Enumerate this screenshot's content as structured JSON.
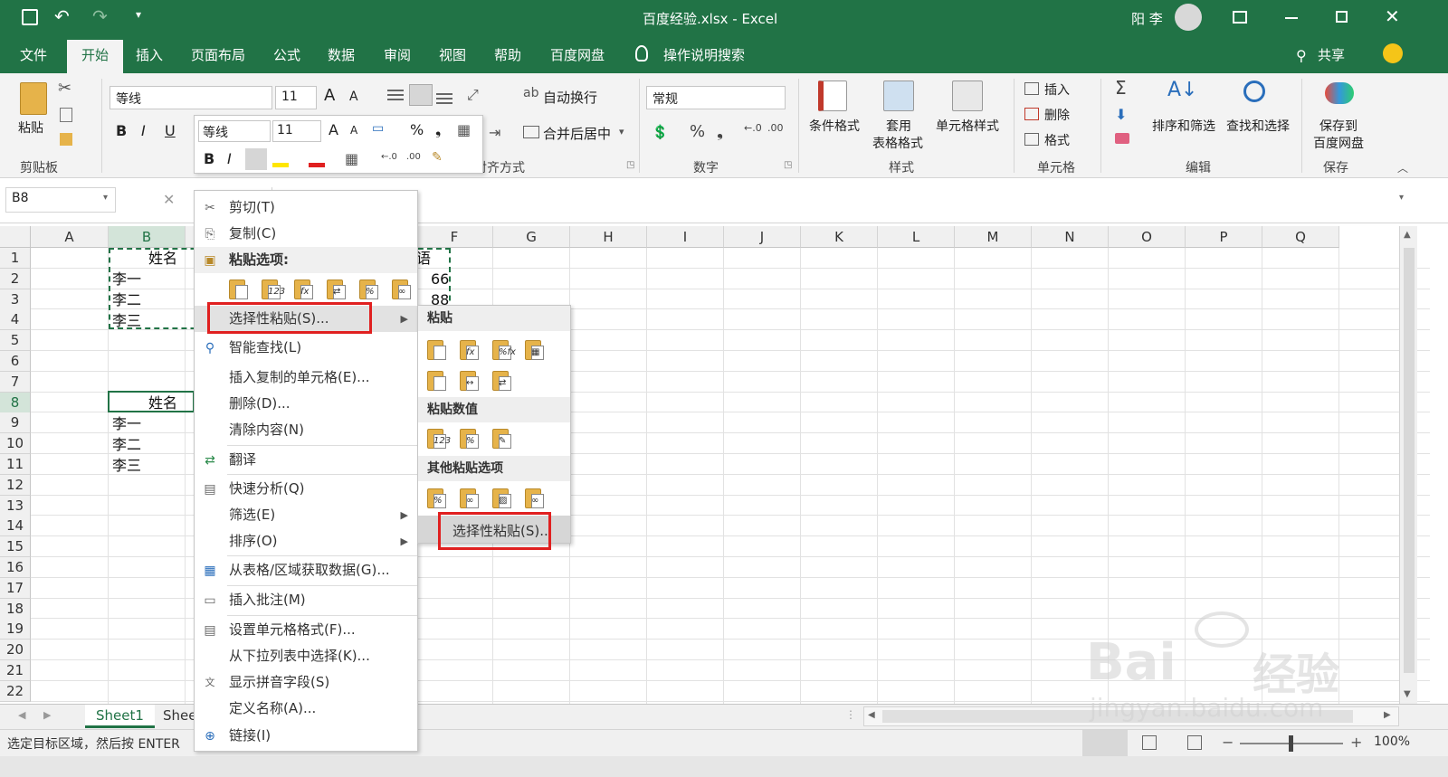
{
  "title": "百度经验.xlsx  -  Excel",
  "user": "阳 李",
  "tabs": [
    "文件",
    "开始",
    "插入",
    "页面布局",
    "公式",
    "数据",
    "审阅",
    "视图",
    "帮助",
    "百度网盘"
  ],
  "tell_me": "操作说明搜索",
  "share": "共享",
  "ribbon": {
    "clipboard": {
      "paste": "粘贴",
      "label": "剪贴板"
    },
    "font": {
      "name": "等线",
      "size": "11",
      "bold": "B",
      "italic": "I",
      "underline": "U"
    },
    "alignment": {
      "wrap": "自动换行",
      "merge": "合并后居中",
      "label": "对齐方式"
    },
    "number": {
      "format": "常规",
      "label": "数字"
    },
    "styles": {
      "cond": "条件格式",
      "table1": "套用",
      "table2": "表格格式",
      "cell": "单元格样式",
      "label": "样式"
    },
    "cells": {
      "insert": "插入",
      "delete": "删除",
      "format": "格式",
      "label": "单元格"
    },
    "editing": {
      "sort": "排序和筛选",
      "find": "查找和选择",
      "label": "编辑"
    },
    "save": {
      "l1": "保存到",
      "l2": "百度网盘",
      "label": "保存"
    }
  },
  "name_box": "B8",
  "columns": [
    "A",
    "B",
    "C",
    "D",
    "E",
    "F",
    "G",
    "H",
    "I",
    "J",
    "K",
    "L",
    "M",
    "N",
    "O",
    "P",
    "Q"
  ],
  "rows": [
    "1",
    "2",
    "3",
    "4",
    "5",
    "6",
    "7",
    "8",
    "9",
    "10",
    "11",
    "12",
    "13",
    "14",
    "15",
    "16",
    "17",
    "18",
    "19",
    "20",
    "21",
    "22"
  ],
  "cells": {
    "b1": "姓名",
    "e1": "语",
    "b2": "李一",
    "e2": "66",
    "b3": "李二",
    "e3": "88",
    "b4": "李三",
    "b8": "姓名",
    "b9": "李一",
    "b10": "李二",
    "b11": "李三"
  },
  "sheets": [
    "Sheet1",
    "Shee"
  ],
  "status": "选定目标区域，然后按 ENTER",
  "zoom": "100%",
  "mini_toolbar": {
    "font": "等线",
    "size": "11"
  },
  "context_menu": {
    "cut": "剪切(T)",
    "copy": "复制(C)",
    "paste_options": "粘贴选项:",
    "paste_special": "选择性粘贴(S)...",
    "smart_lookup": "智能查找(L)",
    "insert_copied": "插入复制的单元格(E)...",
    "delete": "删除(D)...",
    "clear": "清除内容(N)",
    "translate": "翻译",
    "quick_analysis": "快速分析(Q)",
    "filter": "筛选(E)",
    "sort": "排序(O)",
    "get_data": "从表格/区域获取数据(G)...",
    "insert_comment": "插入批注(M)",
    "format_cells": "设置单元格格式(F)...",
    "pick_list": "从下拉列表中选择(K)...",
    "phonetic": "显示拼音字段(S)",
    "define_name": "定义名称(A)...",
    "link": "链接(I)"
  },
  "submenu": {
    "paste": "粘贴",
    "paste_values": "粘贴数值",
    "other": "其他粘贴选项",
    "paste_special": "选择性粘贴(S)..."
  },
  "watermark": {
    "brand": "Bai",
    "brand2": "经验",
    "url": "jingyan.baidu.com"
  },
  "colors": {
    "excel_green": "#217346",
    "highlight": "#e02020"
  }
}
